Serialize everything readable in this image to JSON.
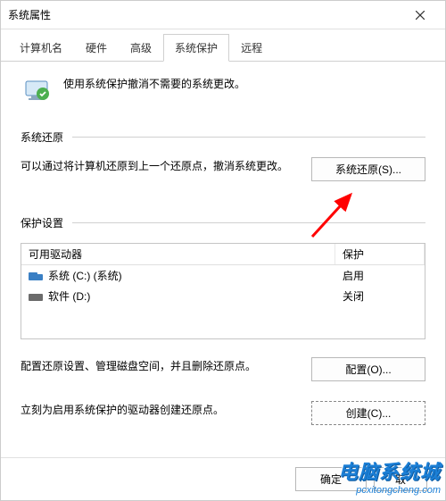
{
  "window": {
    "title": "系统属性"
  },
  "tabs": {
    "items": [
      {
        "label": "计算机名"
      },
      {
        "label": "硬件"
      },
      {
        "label": "高级"
      },
      {
        "label": "系统保护"
      },
      {
        "label": "远程"
      }
    ],
    "activeIndex": 3
  },
  "intro": {
    "text": "使用系统保护撤消不需要的系统更改。"
  },
  "restore": {
    "title": "系统还原",
    "desc": "可以通过将计算机还原到上一个还原点，撤消系统更改。",
    "button": "系统还原(S)..."
  },
  "protection": {
    "title": "保护设置",
    "header_drive": "可用驱动器",
    "header_status": "保护",
    "drives": [
      {
        "icon": "drive-c",
        "label": "系统 (C:) (系统)",
        "status": "启用"
      },
      {
        "icon": "drive-d",
        "label": "软件 (D:)",
        "status": "关闭"
      }
    ],
    "configure_desc": "配置还原设置、管理磁盘空间，并且删除还原点。",
    "configure_button": "配置(O)...",
    "create_desc": "立刻为启用系统保护的驱动器创建还原点。",
    "create_button": "创建(C)..."
  },
  "footer": {
    "ok": "确定",
    "cancel": "取"
  },
  "watermark": {
    "cn": "电脑系统城",
    "en": "pcxitongcheng.com"
  }
}
